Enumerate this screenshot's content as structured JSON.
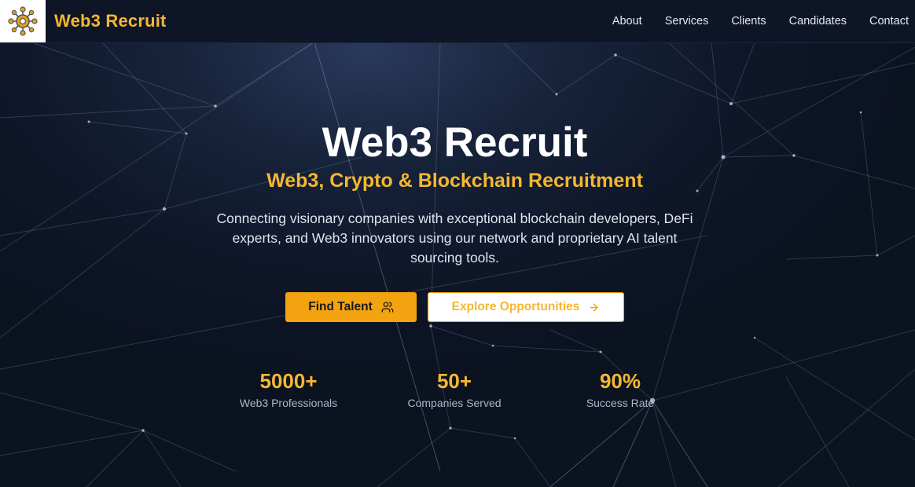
{
  "header": {
    "brand": "Web3 Recruit",
    "logo_icon": "network-hub-icon",
    "nav": [
      {
        "label": "About"
      },
      {
        "label": "Services"
      },
      {
        "label": "Clients"
      },
      {
        "label": "Candidates"
      },
      {
        "label": "Contact"
      }
    ]
  },
  "hero": {
    "title": "Web3 Recruit",
    "subtitle": "Web3, Crypto & Blockchain Recruitment",
    "description": "Connecting visionary companies with exceptional blockchain developers, DeFi experts, and Web3 innovators using our network and proprietary AI talent sourcing tools.",
    "primary_button": {
      "label": "Find Talent",
      "icon": "users-icon"
    },
    "secondary_button": {
      "label": "Explore Opportunities",
      "icon": "arrow-right-icon"
    }
  },
  "stats": [
    {
      "value": "5000+",
      "label": "Web3 Professionals"
    },
    {
      "value": "50+",
      "label": "Companies Served"
    },
    {
      "value": "90%",
      "label": "Success Rate"
    }
  ],
  "colors": {
    "accent": "#f5b731",
    "button": "#f2a30f",
    "background": "#0b1220",
    "header": "#0d1526"
  }
}
